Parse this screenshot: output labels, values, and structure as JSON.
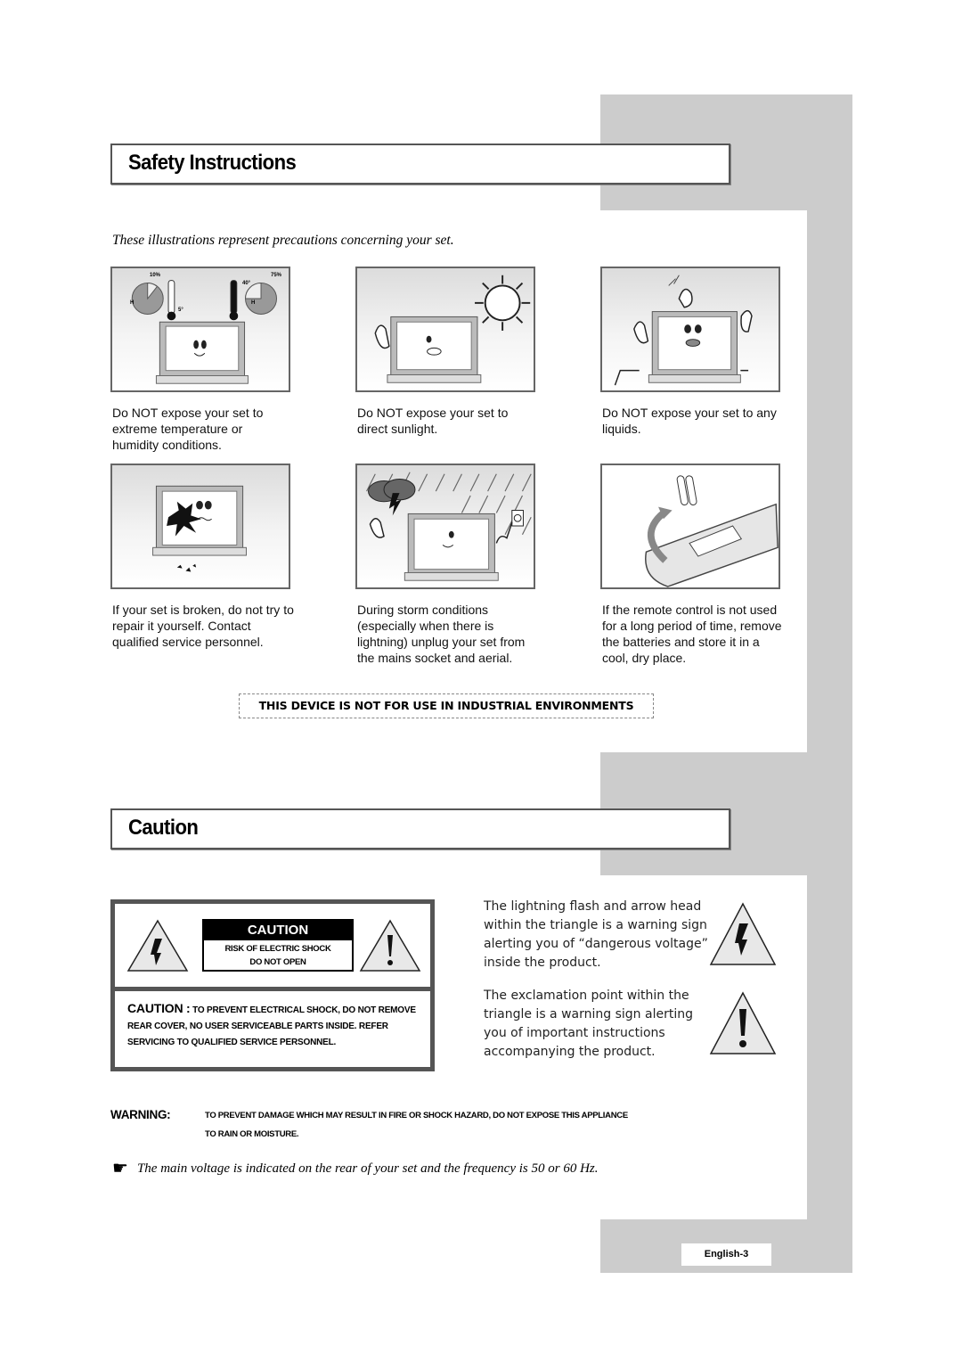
{
  "sections": {
    "safety_title": "Safety Instructions",
    "caution_title": "Caution"
  },
  "subtitle": "These illustrations represent precautions concerning your set.",
  "illustrations": [
    {
      "icon": "tv-temperature-humidity-icon",
      "labels": {
        "h_left": "10%",
        "h_right": "75%",
        "t_low": "5°",
        "t_high": "40°",
        "h": "H"
      },
      "caption": "Do NOT expose your set to extreme temperature or humidity conditions."
    },
    {
      "icon": "tv-sunlight-icon",
      "caption": "Do NOT expose your set to direct sunlight."
    },
    {
      "icon": "tv-liquids-icon",
      "caption": "Do NOT expose your set to any liquids."
    },
    {
      "icon": "tv-broken-icon",
      "caption": "If your set is broken, do not try to repair it yourself. Contact qualified service personnel."
    },
    {
      "icon": "tv-storm-unplug-icon",
      "caption": "During storm conditions (especially when there is lightning) unplug your set from the mains socket and aerial."
    },
    {
      "icon": "remote-batteries-icon",
      "caption": "If the remote control is not used for a long period of time, remove the batteries and store it in a cool, dry place."
    }
  ],
  "notice": "THIS DEVICE IS NOT FOR USE IN INDUSTRIAL ENVIRONMENTS",
  "caution_label": {
    "heading": "CAUTION",
    "line1": "RISK OF ELECTRIC SHOCK",
    "line2": "DO NOT OPEN",
    "body_lead": "CAUTION :",
    "body_text": " TO PREVENT ELECTRICAL SHOCK, DO NOT REMOVE REAR COVER, NO USER SERVICEABLE PARTS INSIDE. REFER SERVICING TO QUALIFIED SERVICE PERSONNEL."
  },
  "symbols": [
    {
      "icon": "lightning-warning-icon",
      "text": "The lightning flash and arrow head within the triangle is a warning sign alerting you of “dangerous voltage” inside the product."
    },
    {
      "icon": "exclamation-warning-icon",
      "text": "The exclamation point within the triangle is a warning sign alerting you of important instructions accompanying the product."
    }
  ],
  "warning": {
    "label": "WARNING:",
    "line1": "TO PREVENT DAMAGE WHICH MAY RESULT IN FIRE OR SHOCK HAZARD, DO NOT EXPOSE THIS APPLIANCE",
    "line2": "TO RAIN OR MOISTURE."
  },
  "note": {
    "icon": "pointing-hand-icon",
    "glyph": "☛",
    "text": "The main voltage is indicated on the rear of your set and the frequency is 50 or 60 Hz."
  },
  "page_label": "English-3"
}
